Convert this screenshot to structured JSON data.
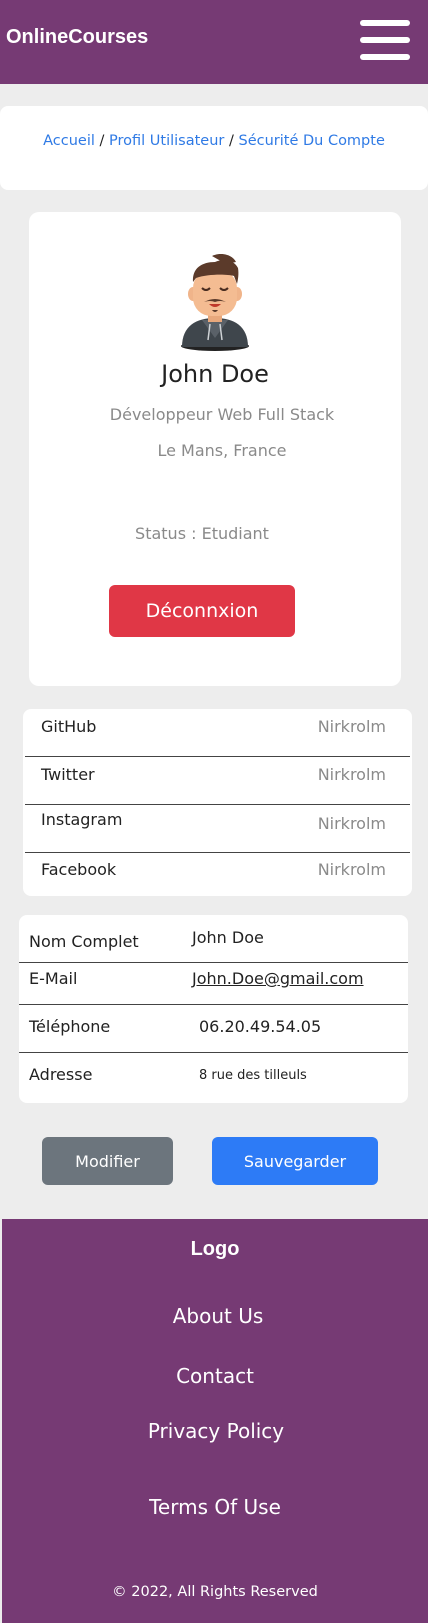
{
  "navbar": {
    "brand": "OnlineCourses",
    "menu_icon": "hamburger-menu-icon"
  },
  "breadcrumb": {
    "items": [
      "Accueil",
      "Profil Utilisateur",
      "Sécurité Du Compte"
    ],
    "separator": "/"
  },
  "profile": {
    "avatar_icon": "user-avatar-icon",
    "name": "John Doe",
    "job": "Développeur Web Full Stack",
    "location": "Le Mans, France",
    "status": "Status : Etudiant",
    "logout_label": "Déconnxion"
  },
  "social": [
    {
      "label": "GitHub",
      "value": "Nirkrolm"
    },
    {
      "label": "Twitter",
      "value": "Nirkrolm"
    },
    {
      "label": "Instagram",
      "value": "Nirkrolm"
    },
    {
      "label": "Facebook",
      "value": "Nirkrolm"
    }
  ],
  "info": [
    {
      "label": "Nom Complet",
      "value": "John Doe"
    },
    {
      "label": "E-Mail",
      "value": "John.Doe@gmail.com"
    },
    {
      "label": "Téléphone",
      "value": "06.20.49.54.05"
    },
    {
      "label": "Adresse",
      "value": "8 rue des tilleuls"
    }
  ],
  "actions": {
    "modify_label": "Modifier",
    "save_label": "Sauvegarder"
  },
  "footer": {
    "logo": "Logo",
    "links": [
      "About Us",
      "Contact",
      "Privacy Policy",
      "Terms Of Use"
    ],
    "copyright": "© 2022,  All Rights Reserved"
  },
  "colors": {
    "brand_purple": "#763a74",
    "danger": "#e03746",
    "primary": "#2d7bf6",
    "secondary": "#6c757d",
    "link": "#2f7ae5"
  }
}
